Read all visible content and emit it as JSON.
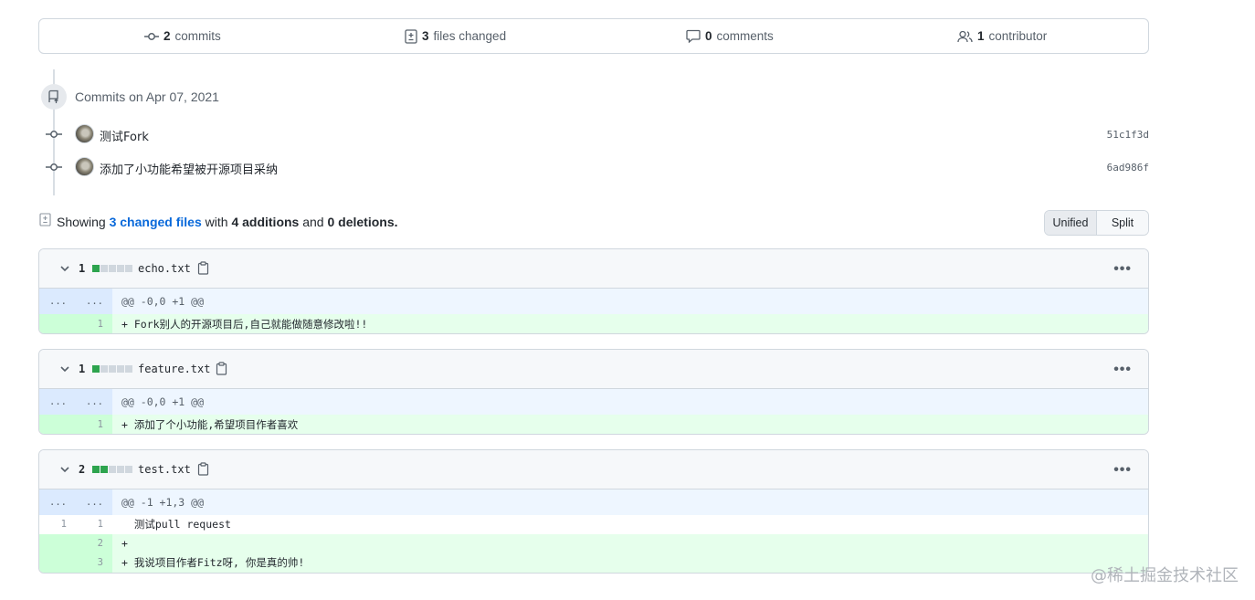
{
  "summary": {
    "commits_count": "2",
    "commits_label": "commits",
    "files_count": "3",
    "files_label": "files changed",
    "comments_count": "0",
    "comments_label": "comments",
    "contributors_count": "1",
    "contributors_label": "contributor"
  },
  "timeline": {
    "date_label": "Commits on Apr 07, 2021",
    "commits": [
      {
        "message": "测试Fork",
        "sha": "51c1f3d"
      },
      {
        "message": "添加了小功能希望被开源项目采纳",
        "sha": "6ad986f"
      }
    ]
  },
  "showing": {
    "prefix": "Showing",
    "files_link": "3 changed files",
    "with": "with",
    "additions": "4 additions",
    "and": "and",
    "deletions": "0 deletions."
  },
  "view_toggle": {
    "unified": "Unified",
    "split": "Split",
    "active": "Unified"
  },
  "files": [
    {
      "count": "1",
      "name": "echo.txt",
      "blocks": [
        1,
        0,
        0,
        0,
        0
      ],
      "hunk": "@@ -0,0 +1 @@",
      "lines": [
        {
          "old": "",
          "new": "1",
          "text": "+ Fork别人的开源项目后,自己就能做随意修改啦!!"
        }
      ]
    },
    {
      "count": "1",
      "name": "feature.txt",
      "blocks": [
        1,
        0,
        0,
        0,
        0
      ],
      "hunk": "@@ -0,0 +1 @@",
      "lines": [
        {
          "old": "",
          "new": "1",
          "text": "+ 添加了个小功能,希望项目作者喜欢"
        }
      ]
    },
    {
      "count": "2",
      "name": "test.txt",
      "blocks": [
        1,
        1,
        0,
        0,
        0
      ],
      "hunk": "@@ -1 +1,3 @@",
      "lines": [
        {
          "old": "1",
          "new": "1",
          "text": "  测试pull request"
        },
        {
          "old": "",
          "new": "2",
          "text": "+"
        },
        {
          "old": "",
          "new": "3",
          "text": "+ 我说项目作者Fitz呀, 你是真的帅!"
        }
      ]
    }
  ],
  "hunk_dots": "...",
  "watermark": "@稀土掘金技术社区",
  "colors": {
    "accent": "#0969da",
    "add_block": "#2da44e",
    "add_bg": "#e6ffec",
    "hunk_bg": "#ddf4ff"
  }
}
